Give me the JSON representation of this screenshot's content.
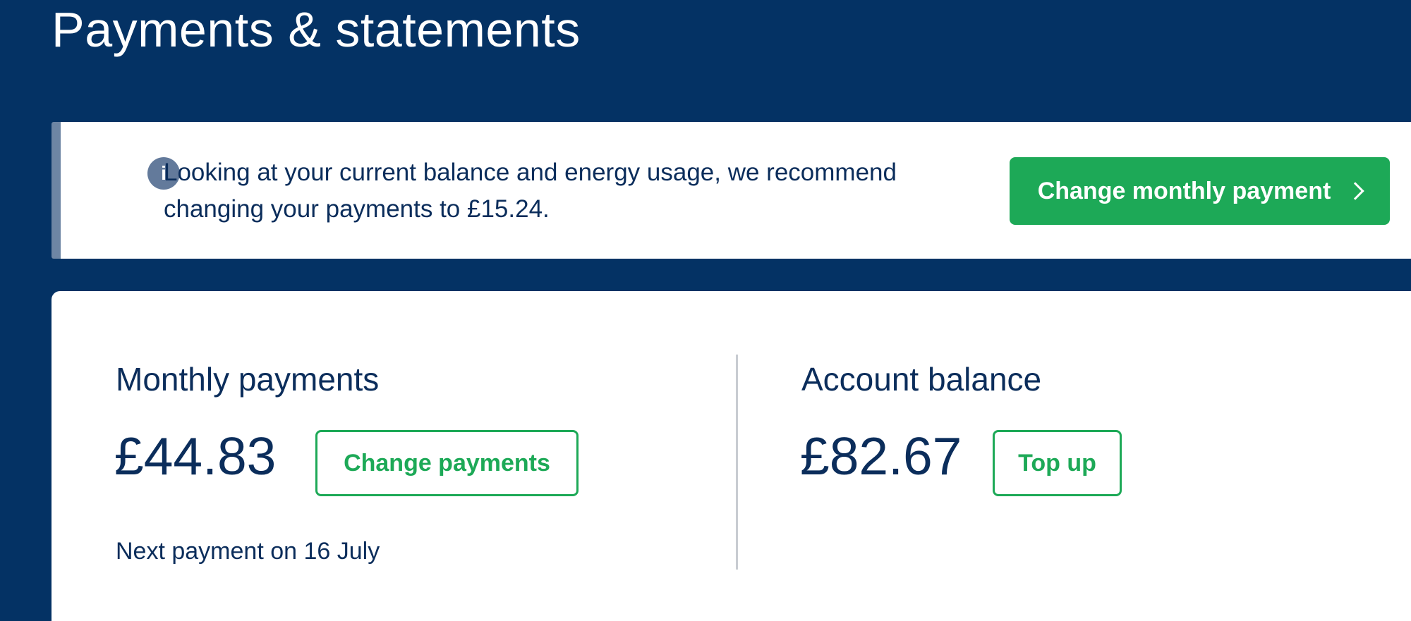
{
  "header": {
    "title": "Payments & statements"
  },
  "banner": {
    "icon": "info-icon",
    "icon_glyph": "i",
    "message": "Looking at your current balance and energy usage, we recommend changing your payments to £15.24.",
    "button_label": "Change monthly payment"
  },
  "monthly_payments": {
    "heading": "Monthly payments",
    "amount": "£44.83",
    "button_label": "Change payments",
    "next_payment": "Next payment on 16 July"
  },
  "account_balance": {
    "heading": "Account balance",
    "amount": "£82.67",
    "button_label": "Top up"
  },
  "colors": {
    "page_background": "#043264",
    "primary_green": "#1da957",
    "text_navy": "#0b2d5b",
    "banner_accent": "#6e86a4"
  }
}
